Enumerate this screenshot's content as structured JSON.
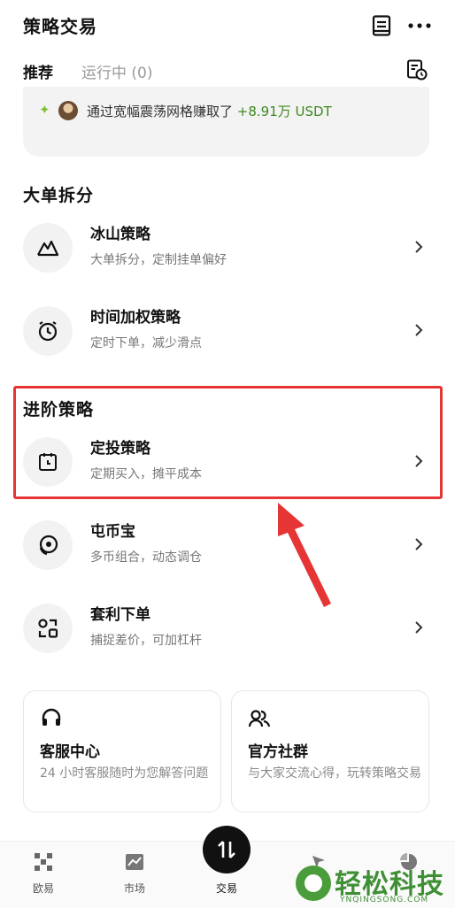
{
  "header": {
    "title": "策略交易",
    "icons": [
      "document-icon",
      "more-icon"
    ]
  },
  "tabs": [
    {
      "label": "推荐",
      "active": true
    },
    {
      "label": "运行中 (0)",
      "active": false
    }
  ],
  "banner": {
    "text_prefix": "通过宽幅震荡网格赚取了",
    "amount": "+8.91万 USDT"
  },
  "sections": [
    {
      "title": "大单拆分",
      "items": [
        {
          "title": "冰山策略",
          "desc": "大单拆分，定制挂单偏好",
          "icon": "mountain-icon"
        },
        {
          "title": "时间加权策略",
          "desc": "定时下单，减少滑点",
          "icon": "alarm-clock-icon"
        }
      ]
    },
    {
      "title": "进阶策略",
      "items": [
        {
          "title": "定投策略",
          "desc": "定期买入，摊平成本",
          "icon": "calendar-clock-icon"
        },
        {
          "title": "屯币宝",
          "desc": "多币组合，动态调仓",
          "icon": "coin-target-icon"
        },
        {
          "title": "套利下单",
          "desc": "捕捉差价，可加杠杆",
          "icon": "arbitrage-icon"
        }
      ]
    }
  ],
  "cards": [
    {
      "title": "客服中心",
      "desc": "24 小时客服随时为您解答问题",
      "icon": "headset-icon"
    },
    {
      "title": "官方社群",
      "desc": "与大家交流心得，玩转策略交易",
      "icon": "community-icon"
    }
  ],
  "tabbar": [
    {
      "label": "欧易",
      "icon": "okx-logo-icon"
    },
    {
      "label": "市场",
      "icon": "market-chart-icon"
    },
    {
      "label": "交易",
      "icon": "trade-arrows-icon"
    }
  ],
  "watermark": {
    "text": "轻松科技",
    "sub": "YNQINGSONG.COM"
  },
  "colors": {
    "highlight": "#e53535",
    "arrow": "#e53535",
    "profit": "#3e8a1e",
    "watermark": "#3f8f35"
  }
}
